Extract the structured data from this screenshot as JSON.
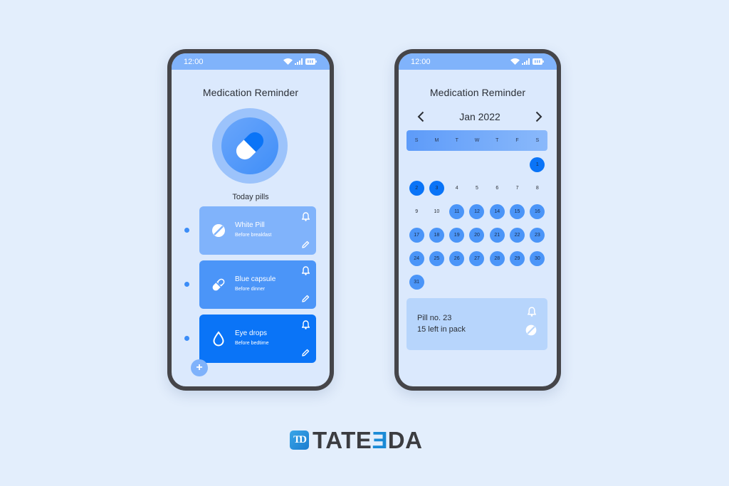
{
  "left_phone": {
    "status_bar": {
      "time": "12:00",
      "icons": [
        "wifi-icon",
        "signal-icon",
        "battery-icon"
      ]
    },
    "title": "Medication Reminder",
    "hero_icon": "capsule-icon",
    "today_label": "Today pills",
    "pills": [
      {
        "name": "White Pill",
        "when": "Before breakfast",
        "icon": "tablet-icon",
        "color": "#80b3fb"
      },
      {
        "name": "Blue capsule",
        "when": "Before dinner",
        "icon": "capsule-icon",
        "color": "#4b95f8"
      },
      {
        "name": "Eye drops",
        "when": "Before bedtime",
        "icon": "drop-icon",
        "color": "#0a74f7"
      }
    ],
    "add_button": "+"
  },
  "right_phone": {
    "status_bar": {
      "time": "12:00",
      "icons": [
        "wifi-icon",
        "signal-icon",
        "battery-icon"
      ]
    },
    "title": "Medication Reminder",
    "month": "Jan 2022",
    "weekdays": [
      "S",
      "M",
      "T",
      "W",
      "T",
      "F",
      "S"
    ],
    "calendar": [
      {
        "label": "",
        "state": "empty"
      },
      {
        "label": "",
        "state": "empty"
      },
      {
        "label": "",
        "state": "empty"
      },
      {
        "label": "",
        "state": "empty"
      },
      {
        "label": "",
        "state": "empty"
      },
      {
        "label": "",
        "state": "empty"
      },
      {
        "label": "1",
        "state": "taken"
      },
      {
        "label": "2",
        "state": "taken"
      },
      {
        "label": "3",
        "state": "taken"
      },
      {
        "label": "4",
        "state": "none"
      },
      {
        "label": "5",
        "state": "none"
      },
      {
        "label": "6",
        "state": "none"
      },
      {
        "label": "7",
        "state": "none"
      },
      {
        "label": "8",
        "state": "none"
      },
      {
        "label": "9",
        "state": "none"
      },
      {
        "label": "10",
        "state": "none"
      },
      {
        "label": "11",
        "state": "planned"
      },
      {
        "label": "12",
        "state": "planned"
      },
      {
        "label": "14",
        "state": "planned"
      },
      {
        "label": "15",
        "state": "planned"
      },
      {
        "label": "16",
        "state": "planned"
      },
      {
        "label": "17",
        "state": "planned"
      },
      {
        "label": "18",
        "state": "planned"
      },
      {
        "label": "19",
        "state": "planned"
      },
      {
        "label": "20",
        "state": "planned"
      },
      {
        "label": "21",
        "state": "planned"
      },
      {
        "label": "22",
        "state": "planned"
      },
      {
        "label": "23",
        "state": "planned"
      },
      {
        "label": "24",
        "state": "planned"
      },
      {
        "label": "25",
        "state": "planned"
      },
      {
        "label": "26",
        "state": "planned"
      },
      {
        "label": "27",
        "state": "planned"
      },
      {
        "label": "28",
        "state": "planned"
      },
      {
        "label": "29",
        "state": "planned"
      },
      {
        "label": "30",
        "state": "planned"
      },
      {
        "label": "31",
        "state": "planned"
      }
    ],
    "info_card": {
      "line1": "Pill no. 23",
      "line2": "15 left in pack"
    }
  },
  "brand": {
    "mark": "TD",
    "text_before": "TATE",
    "accent_letter": "E",
    "text_after": "DA"
  },
  "colors": {
    "background": "#e3eefc",
    "screen": "#dbe9fd",
    "status_bar": "#80b3fb",
    "taken": "#0a74f7",
    "planned": "#4b95f8",
    "frame": "#454549"
  }
}
